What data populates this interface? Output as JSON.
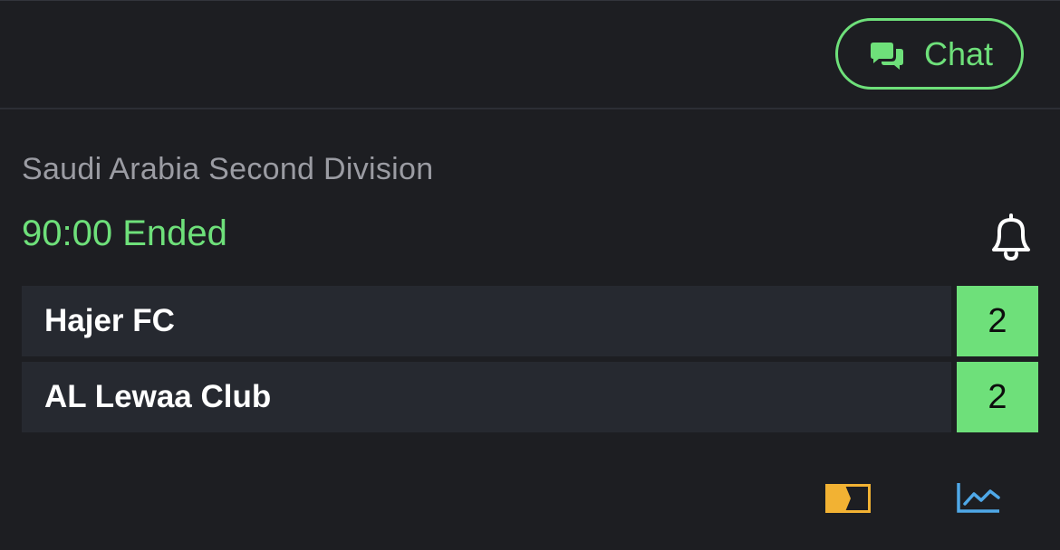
{
  "header": {
    "chat_label": "Chat"
  },
  "match": {
    "league": "Saudi Arabia Second Division",
    "status": "90:00 Ended",
    "teams": [
      {
        "name": "Hajer FC",
        "score": "2"
      },
      {
        "name": "AL Lewaa Club",
        "score": "2"
      }
    ]
  },
  "icons": {
    "chat": "chat-bubbles-icon",
    "bell": "bell-icon",
    "tv": "tv-stream-icon",
    "stats": "stats-chart-icon"
  },
  "colors": {
    "accent": "#6ee07a",
    "background": "#1d1e22",
    "row_background": "#262930",
    "muted_text": "#9b9ca3",
    "tv_icon": "#f2b233",
    "stats_icon": "#4fa8e8"
  }
}
